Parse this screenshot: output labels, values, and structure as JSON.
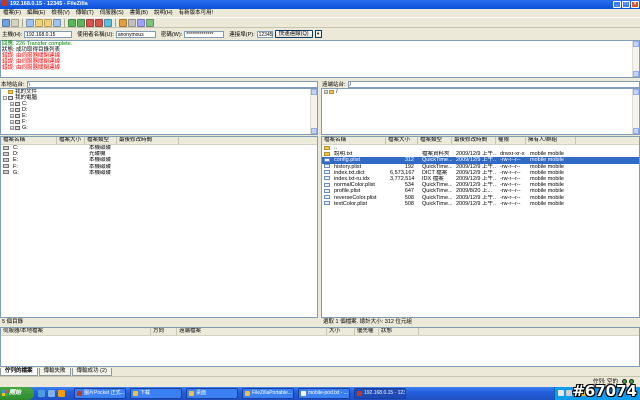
{
  "window": {
    "title": "192.168.0.15 - 12345 - FileZilla",
    "minimize": "_",
    "maximize": "□",
    "close": "×"
  },
  "menu": [
    "檔案(F)",
    "編輯(E)",
    "檢視(V)",
    "傳輸(T)",
    "伺服器(S)",
    "書籤(B)",
    "說明(H)",
    "有新版本可用!"
  ],
  "toolbar": {
    "icons": [
      {
        "name": "site-manager-icon",
        "color": "#6fa0e0"
      },
      {
        "name": "dropdown-arrow-icon",
        "color": "#d8d4c4"
      },
      {
        "name": "sep"
      },
      {
        "name": "toggle-log-icon",
        "color": "#9bc2f0"
      },
      {
        "name": "toggle-local-tree-icon",
        "color": "#f0d27a"
      },
      {
        "name": "toggle-remote-tree-icon",
        "color": "#f0d27a"
      },
      {
        "name": "toggle-queue-icon",
        "color": "#9bc2f0"
      },
      {
        "name": "sep"
      },
      {
        "name": "refresh-icon",
        "color": "#5cb85c"
      },
      {
        "name": "process-queue-icon",
        "color": "#5cb85c"
      },
      {
        "name": "cancel-icon",
        "color": "#d9534f"
      },
      {
        "name": "disconnect-icon",
        "color": "#d9534f"
      },
      {
        "name": "reconnect-icon",
        "color": "#5bc0de"
      },
      {
        "name": "sep"
      },
      {
        "name": "filter-icon",
        "color": "#e0a040"
      },
      {
        "name": "sync-browse-icon",
        "color": "#c0c0c0"
      },
      {
        "name": "compare-icon",
        "color": "#a0a0ff"
      },
      {
        "name": "search-icon",
        "color": "#80c080"
      }
    ]
  },
  "quickconnect": {
    "host_label": "主機(H):",
    "host": "192.168.0.15",
    "user_label": "使用者名稱(U):",
    "user": "anonymous",
    "pass_label": "密碼(W):",
    "pass": "**************",
    "port_label": "連接埠(P):",
    "port": "12345",
    "button": "快速連線(Q)",
    "dropdown": "▼"
  },
  "log": [
    {
      "tag": "回應:",
      "text": "226 Transfer complete.",
      "color": "#008000"
    },
    {
      "tag": "狀態:",
      "text": "成功取得目錄列表",
      "color": "#000000"
    },
    {
      "tag": "錯誤:",
      "text": "由伺服器關閉連線",
      "color": "#ff0000"
    },
    {
      "tag": "錯誤:",
      "text": "由伺服器關閉連線",
      "color": "#ff0000"
    },
    {
      "tag": "錯誤:",
      "text": "由伺服器關閉連線",
      "color": "#ff0000"
    }
  ],
  "local": {
    "site_label": "本地站台:",
    "path": "\\",
    "tree": [
      {
        "label": "我的文件",
        "level": 1,
        "icon": "folder"
      },
      {
        "label": "我的電腦",
        "level": 1,
        "icon": "computer",
        "expanded": "-"
      },
      {
        "label": "C:",
        "level": 2,
        "icon": "drive",
        "expanded": "+"
      },
      {
        "label": "D:",
        "level": 2,
        "icon": "drive",
        "expanded": "+"
      },
      {
        "label": "E:",
        "level": 2,
        "icon": "drive",
        "expanded": "+"
      },
      {
        "label": "F:",
        "level": 2,
        "icon": "drive",
        "expanded": "+"
      },
      {
        "label": "G:",
        "level": 2,
        "icon": "drive",
        "expanded": "+"
      }
    ],
    "columns": [
      "檔案名稱",
      "檔案大小",
      "檔案類型",
      "最後修改時間"
    ],
    "rows": [
      [
        "C:",
        "",
        "本機磁碟",
        ""
      ],
      [
        "D:",
        "",
        "光碟機",
        ""
      ],
      [
        "E:",
        "",
        "本機磁碟",
        ""
      ],
      [
        "F:",
        "",
        "本機磁碟",
        ""
      ],
      [
        "G:",
        "",
        "本機磁碟",
        ""
      ]
    ],
    "status": "5 個目錄"
  },
  "remote": {
    "site_label": "遠端站台:",
    "path": "/",
    "tree": [
      {
        "label": "/",
        "level": 1,
        "icon": "folder",
        "expanded": "+"
      }
    ],
    "columns": [
      "檔案名稱",
      "檔案大小",
      "檔案類型",
      "最後修改時間",
      "權限",
      "擁有人/群組"
    ],
    "rows": [
      {
        "cells": [
          "..",
          "",
          "",
          "",
          "",
          ""
        ],
        "icon": "folder",
        "selected": false
      },
      {
        "cells": [
          "說明.txt",
          "",
          "檔案資料夾",
          "2009/12/9 上午...",
          "drwxr-xr-x",
          "mobile mobile"
        ],
        "icon": "folder",
        "selected": false
      },
      {
        "cells": [
          "config.plist",
          "312",
          "QuickTime...",
          "2009/12/9 上午...",
          "-rw-r--r--",
          "mobile mobile"
        ],
        "icon": "file",
        "selected": true
      },
      {
        "cells": [
          "history.plist",
          "192",
          "QuickTime...",
          "2009/12/9 上午...",
          "-rw-r--r--",
          "mobile mobile"
        ],
        "icon": "file",
        "selected": false
      },
      {
        "cells": [
          "index.txt.dict",
          "6,573,167",
          "DICT 檔案",
          "2009/12/9 上午...",
          "-rw-r--r--",
          "mobile mobile"
        ],
        "icon": "file",
        "selected": false
      },
      {
        "cells": [
          "index.txt-ru.idx",
          "3,772,514",
          "IDX 檔案",
          "2009/12/9 上午...",
          "-rw-r--r--",
          "mobile mobile"
        ],
        "icon": "file",
        "selected": false
      },
      {
        "cells": [
          "normalColor.plist",
          "534",
          "QuickTime...",
          "2009/12/9 上午...",
          "-rw-r--r--",
          "mobile mobile"
        ],
        "icon": "file",
        "selected": false
      },
      {
        "cells": [
          "profile.plist",
          "647",
          "QuickTime...",
          "2009/8/20 上...",
          "-rw-r--r--",
          "mobile mobile"
        ],
        "icon": "file",
        "selected": false
      },
      {
        "cells": [
          "reverseColor.plist",
          "508",
          "QuickTime...",
          "2009/12/9 上午...",
          "-rw-r--r--",
          "mobile mobile"
        ],
        "icon": "file",
        "selected": false
      },
      {
        "cells": [
          "textColor.plist",
          "508",
          "QuickTime...",
          "2009/12/9 上午...",
          "-rw-r--r--",
          "mobile mobile"
        ],
        "icon": "file",
        "selected": false
      }
    ],
    "status": "選取 1 個檔案. 總計大小: 312 位元組"
  },
  "queue": {
    "columns": [
      "伺服器/本地檔案",
      "方向",
      "遠端檔案",
      "大小",
      "優先權",
      "狀態"
    ],
    "tabs": [
      {
        "label": "佇列的檔案",
        "active": true
      },
      {
        "label": "傳輸失敗",
        "active": false
      },
      {
        "label": "傳輸成功 (2)",
        "active": false
      }
    ],
    "status": "佇列: 空的"
  },
  "taskbar": {
    "start": "開始",
    "quicklaunch": [
      {
        "name": "ie-icon",
        "color": "#4a9de0"
      },
      {
        "name": "desktop-icon",
        "color": "#7fb2ee"
      },
      {
        "name": "media-player-icon",
        "color": "#f39c12"
      }
    ],
    "tasks": [
      {
        "label": "圖片Pocket 正式...",
        "icon_color": "#c0392b",
        "active": false
      },
      {
        "label": "下載",
        "icon_color": "#f0c040",
        "active": false
      },
      {
        "label": "桌面",
        "icon_color": "#f0c040",
        "active": false
      },
      {
        "label": "FileZillaPortable...",
        "icon_color": "#f0c040",
        "active": false
      },
      {
        "label": "mobile-pod.txt - ...",
        "icon_color": "#ffffff",
        "active": false
      },
      {
        "label": "192.168.0.15 - 123...",
        "icon_color": "#c0392b",
        "active": true
      }
    ],
    "tray": [
      {
        "name": "network-icon",
        "color": "#e8e8e8"
      },
      {
        "name": "volume-icon",
        "color": "#d0d0d0"
      },
      {
        "name": "antivirus-icon",
        "color": "#e74c3c"
      },
      {
        "name": "ime-icon",
        "color": "#f1c40f"
      }
    ]
  },
  "watermark": "#67074"
}
